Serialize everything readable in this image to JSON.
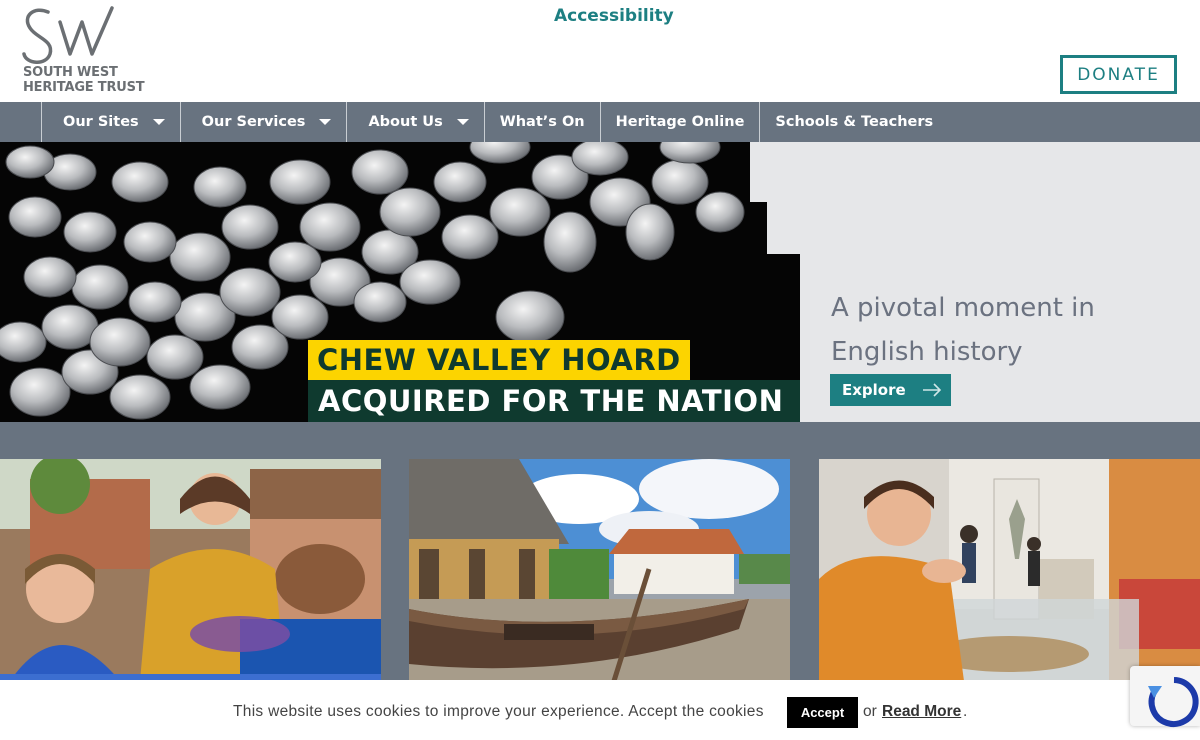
{
  "header": {
    "logo_monogram": "SW",
    "logo_line1": "SOUTH WEST",
    "logo_line2": "HERITAGE TRUST",
    "accessibility_label": "Accessibility",
    "donate_label": "DONATE"
  },
  "nav": {
    "items": [
      {
        "label": "Our Sites",
        "has_dropdown": true
      },
      {
        "label": "Our Services",
        "has_dropdown": true
      },
      {
        "label": "About Us",
        "has_dropdown": true
      },
      {
        "label": "What’s On",
        "has_dropdown": false
      },
      {
        "label": "Heritage Online",
        "has_dropdown": false
      },
      {
        "label": "Schools & Teachers",
        "has_dropdown": false
      }
    ]
  },
  "hero": {
    "headline_line1": "CHEW VALLEY HOARD",
    "headline_line2": "ACQUIRED FOR THE NATION",
    "tagline": "A pivotal moment in English history",
    "cta_label": "Explore"
  },
  "cookie": {
    "message": "This website uses cookies to improve your experience. Accept the cookies",
    "accept_label": "Accept",
    "or_text": "or",
    "read_more_label": "Read More",
    "end_punct": "."
  },
  "colors": {
    "teal": "#1d7f82",
    "nav_bg": "#687380",
    "hero_bg": "#e6e7e9",
    "highlight_yellow": "#fcd400",
    "dark_green": "#0f3a2f"
  }
}
